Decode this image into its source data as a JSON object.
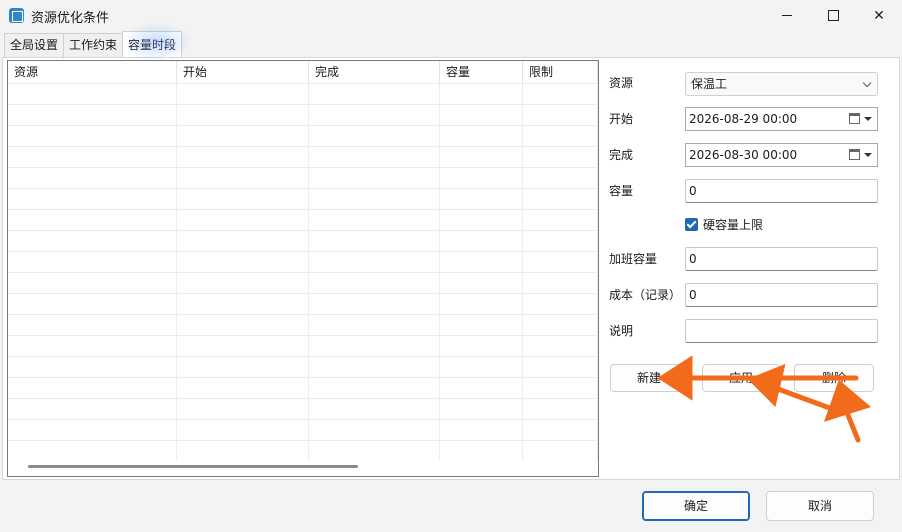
{
  "window": {
    "title": "资源优化条件"
  },
  "tabs": [
    {
      "label": "全局设置"
    },
    {
      "label": "工作约束"
    },
    {
      "label": "容量时段"
    }
  ],
  "table": {
    "columns": [
      "资源",
      "开始",
      "完成",
      "容量",
      "限制"
    ],
    "rows": []
  },
  "form": {
    "resource_label": "资源",
    "resource_value": "保温工",
    "start_label": "开始",
    "start_value": "2026-08-29 00:00",
    "finish_label": "完成",
    "finish_value": "2026-08-30 00:00",
    "capacity_label": "容量",
    "capacity_value": "0",
    "hard_limit_label": "硬容量上限",
    "hard_limit_checked": true,
    "overtime_label": "加班容量",
    "overtime_value": "0",
    "cost_label": "成本（记录）",
    "cost_value": "0",
    "note_label": "说明",
    "note_value": ""
  },
  "actions": {
    "new_label": "新建",
    "apply_label": "应用",
    "delete_label": "删除"
  },
  "footer": {
    "ok_label": "确定",
    "cancel_label": "取消"
  },
  "colors": {
    "accent": "#1f68b5",
    "annotation": "#f26a1b"
  }
}
